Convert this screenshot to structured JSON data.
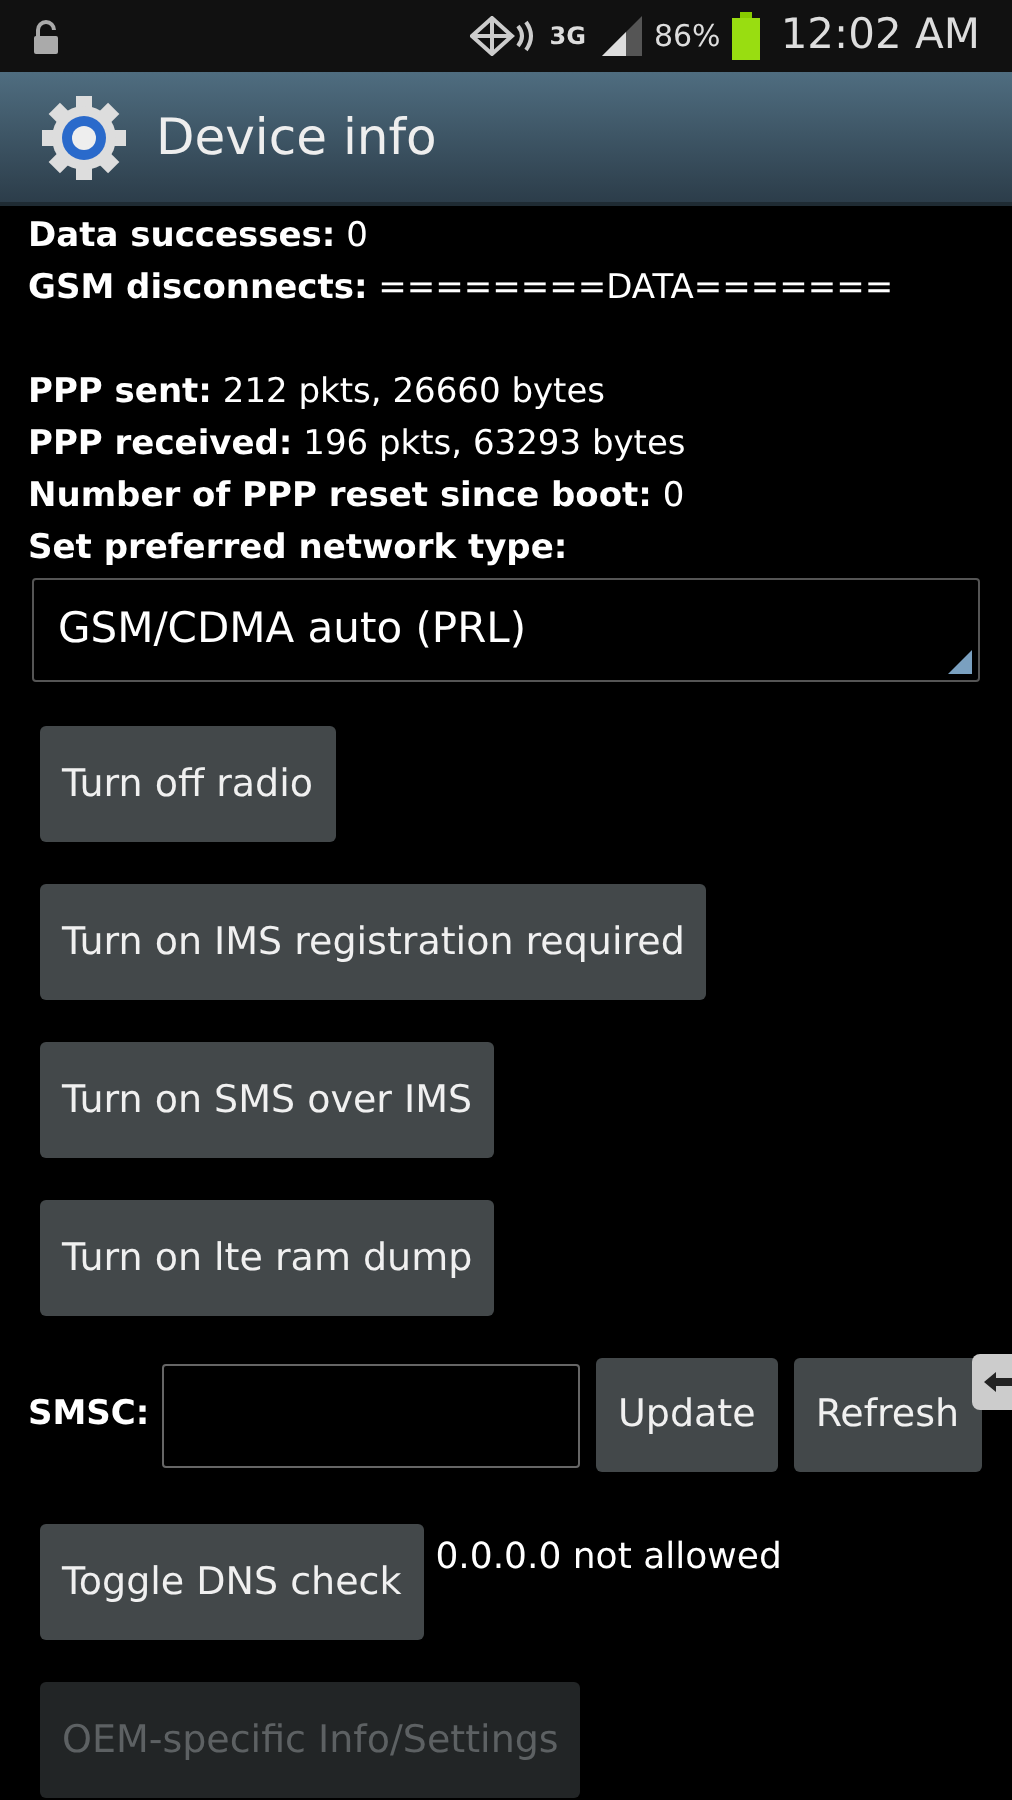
{
  "status_bar": {
    "network": "3G",
    "battery": "86%",
    "time": "12:02 AM"
  },
  "action_bar": {
    "title": "Device info"
  },
  "info_groups": [
    {
      "lines": [
        "**Data successes:** 0",
        "**GSM disconnects:** ========DATA======="
      ]
    },
    {
      "lines": [
        "**PPP sent:** 212 pkts, 26660 bytes",
        "**PPP received:** 196 pkts, 63293 bytes",
        "**Number of PPP reset since boot:** 0",
        "**Set preferred network type:**"
      ]
    }
  ],
  "network_type": {
    "value": "GSM/CDMA auto (PRL)"
  },
  "buttons": [
    {
      "label": "Turn off radio",
      "disabled": false
    },
    {
      "label": "Turn on IMS registration required",
      "disabled": false
    },
    {
      "label": "Turn on SMS over IMS",
      "disabled": false
    },
    {
      "label": "Turn on lte ram dump",
      "disabled": false
    }
  ],
  "smsc": {
    "label": "SMSC:",
    "buttons": [
      "Update",
      "Refresh"
    ]
  },
  "dns": {
    "button": "Toggle DNS check",
    "status": "0.0.0.0 not allowed"
  },
  "oem_button": {
    "label": "OEM-specific Info/Settings",
    "disabled": true
  }
}
